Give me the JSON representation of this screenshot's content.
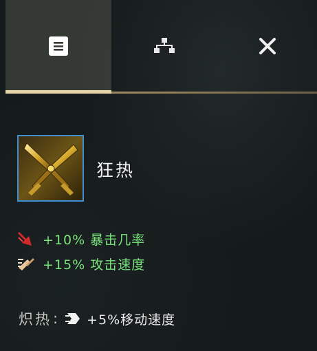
{
  "tabs": {
    "summary_icon": "list-icon",
    "tree_icon": "build-tree-icon",
    "close_icon": "close-icon"
  },
  "item": {
    "name": "狂热",
    "icon": "crossed-blades-icon",
    "border_color": "#3f8fd0"
  },
  "stats": [
    {
      "icon": "crit-arrow-icon",
      "text": "+10% 暴击几率"
    },
    {
      "icon": "attack-speed-icon",
      "text": "+15% 攻击速度"
    }
  ],
  "passive": {
    "name": "炽热",
    "colon": ":",
    "icon": "move-speed-icon",
    "text": "+5%移动速度"
  },
  "colors": {
    "stat_green": "#79e37c",
    "gold_line": "#b8a37a",
    "background": "#151a1b"
  }
}
